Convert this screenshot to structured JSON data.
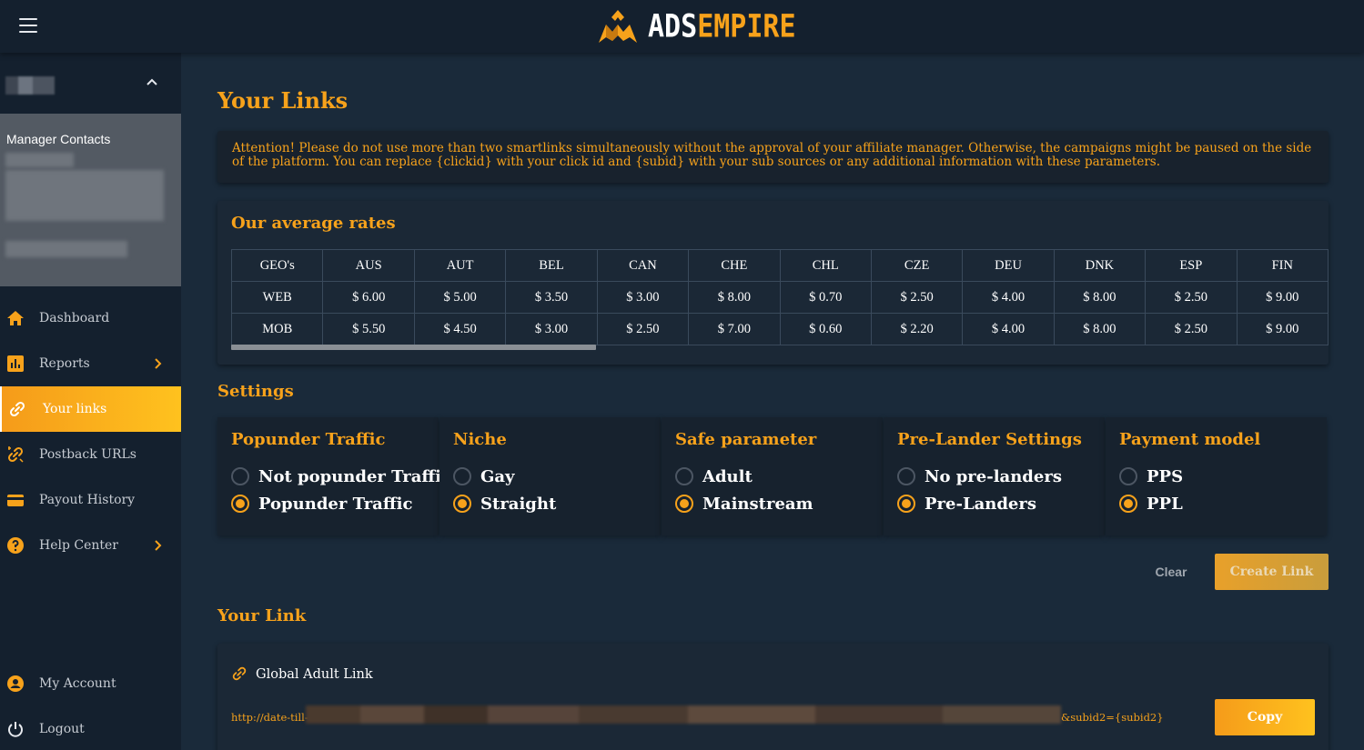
{
  "brand": {
    "name_part1": "ADS",
    "name_part2": "EMPIRE",
    "accent": "#f7a21b"
  },
  "sidebar": {
    "manager_title": "Manager Contacts",
    "items": [
      {
        "label": "Dashboard",
        "icon": "home-icon"
      },
      {
        "label": "Reports",
        "icon": "chart-icon"
      },
      {
        "label": "Your links",
        "icon": "link-icon"
      },
      {
        "label": "Postback URLs",
        "icon": "postback-icon"
      },
      {
        "label": "Payout History",
        "icon": "card-icon"
      },
      {
        "label": "Help Center",
        "icon": "help-icon"
      },
      {
        "label": "My Account",
        "icon": "account-icon"
      },
      {
        "label": "Logout",
        "icon": "power-icon"
      }
    ]
  },
  "page": {
    "title": "Your Links",
    "alert": "Attention! Please do not use more than two smartlinks simultaneously without the approval of your affiliate manager. Otherwise, the campaigns might be paused on the side of the platform. You can replace {clickid} with your click id and {subid} with your sub sources or any additional information with these parameters."
  },
  "rates": {
    "title": "Our average rates",
    "header": [
      "GEO's",
      "AUS",
      "AUT",
      "BEL",
      "CAN",
      "CHE",
      "CHL",
      "CZE",
      "DEU",
      "DNK",
      "ESP",
      "FIN"
    ],
    "rows": [
      [
        "WEB",
        "$ 6.00",
        "$ 5.00",
        "$ 3.50",
        "$ 3.00",
        "$ 8.00",
        "$ 0.70",
        "$ 2.50",
        "$ 4.00",
        "$ 8.00",
        "$ 2.50",
        "$ 9.00"
      ],
      [
        "MOB",
        "$ 5.50",
        "$ 4.50",
        "$ 3.00",
        "$ 2.50",
        "$ 7.00",
        "$ 0.60",
        "$ 2.20",
        "$ 4.00",
        "$ 8.00",
        "$ 2.50",
        "$ 9.00"
      ]
    ]
  },
  "settings": {
    "title": "Settings",
    "groups": [
      {
        "title": "Popunder Traffic",
        "options": [
          "Not popunder Traffic",
          "Popunder Traffic"
        ],
        "selected": 1
      },
      {
        "title": "Niche",
        "options": [
          "Gay",
          "Straight"
        ],
        "selected": 1
      },
      {
        "title": "Safe parameter",
        "options": [
          "Adult",
          "Mainstream"
        ],
        "selected": 1
      },
      {
        "title": "Pre-Lander Settings",
        "options": [
          "No pre-landers",
          "Pre-Landers"
        ],
        "selected": 1
      },
      {
        "title": "Payment model",
        "options": [
          "PPS",
          "PPL"
        ],
        "selected": 1
      }
    ],
    "clear_label": "Clear",
    "create_label": "Create Link"
  },
  "your_link": {
    "title": "Your Link",
    "link_title": "Global Adult Link",
    "url_start": "http://date-till-",
    "url_end": "&subid2={subid2}",
    "copy_label": "Copy"
  }
}
